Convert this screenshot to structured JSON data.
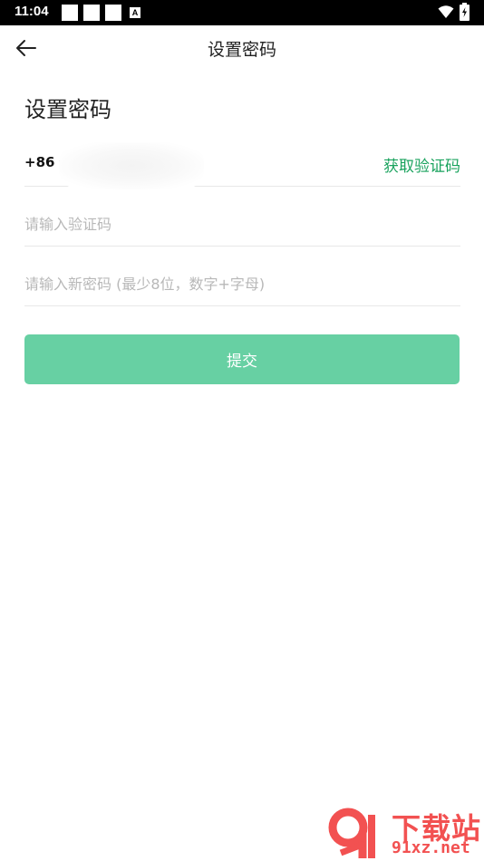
{
  "status_bar": {
    "time": "11:04",
    "notification_badge": "A"
  },
  "header": {
    "title": "设置密码"
  },
  "page": {
    "heading": "设置密码"
  },
  "phone_field": {
    "country_code": "+86",
    "get_code_label": "获取验证码"
  },
  "code_field": {
    "placeholder": "请输入验证码",
    "value": ""
  },
  "password_field": {
    "placeholder": "请输入新密码 (最少8位，数字+字母)",
    "value": ""
  },
  "submit": {
    "label": "提交"
  },
  "watermark": {
    "brand_text": "下载站",
    "url_text": "91xz.net"
  },
  "colors": {
    "accent": "#1aa35e",
    "button": "#67d0a3",
    "watermark": "#f25151"
  }
}
